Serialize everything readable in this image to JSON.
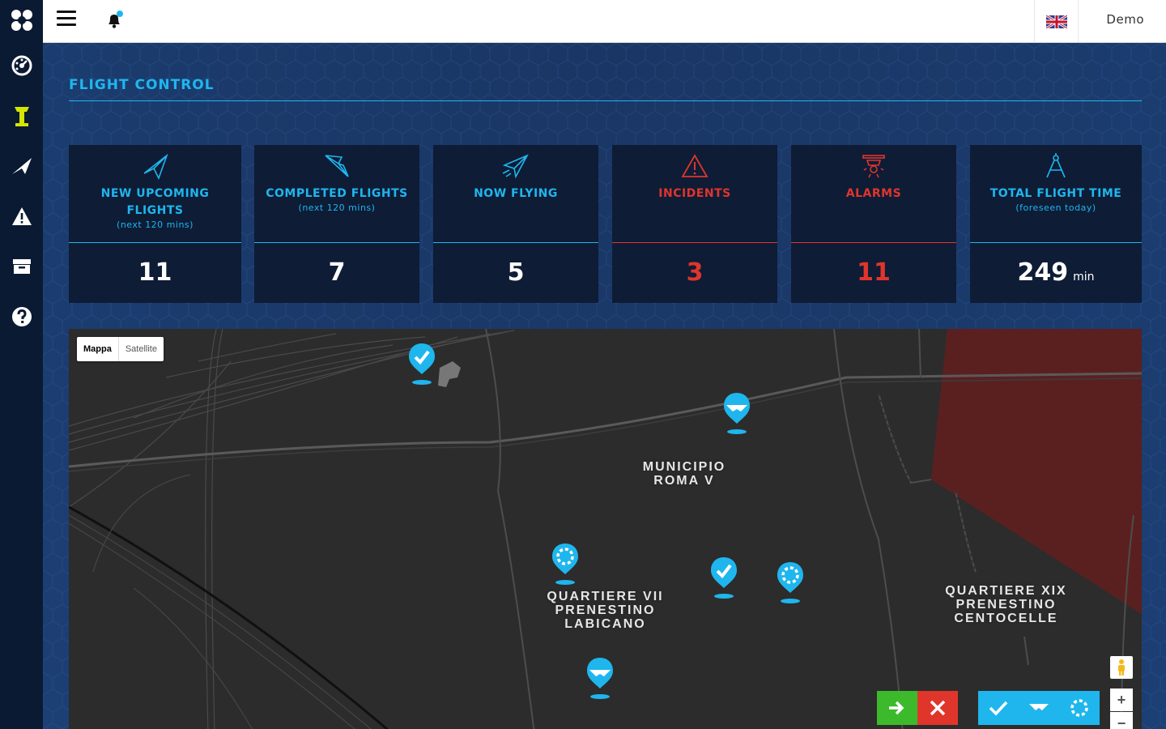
{
  "sidebar": {
    "items": [
      {
        "icon": "logo-icon"
      },
      {
        "icon": "dashboard-gauge-icon"
      },
      {
        "icon": "flight-control-tower-icon",
        "color": "#d4e600"
      },
      {
        "icon": "paper-plane-icon"
      },
      {
        "icon": "warning-icon"
      },
      {
        "icon": "archive-icon"
      },
      {
        "icon": "help-icon"
      }
    ]
  },
  "topbar": {
    "language_flag": "uk-flag-icon",
    "user_name": "Demo",
    "notification_dot_color": "#1fb6ee"
  },
  "page": {
    "title": "FLIGHT CONTROL"
  },
  "cards": [
    {
      "icon": "paper-plane-outline-icon",
      "label": "NEW UPCOMING FLIGHTS",
      "sub": "(next 120 mins)",
      "value": "11",
      "unit": "",
      "color": "#1fb6ee"
    },
    {
      "icon": "folded-plane-icon",
      "label": "COMPLETED FLIGHTS",
      "sub": "(next 120 mins)",
      "value": "7",
      "unit": "",
      "color": "#1fb6ee"
    },
    {
      "icon": "flying-plane-icon",
      "label": "NOW FLYING",
      "sub": "",
      "value": "5",
      "unit": "",
      "color": "#1fb6ee"
    },
    {
      "icon": "warning-triangle-icon",
      "label": "INCIDENTS",
      "sub": "",
      "value": "3",
      "unit": "",
      "color": "#e0352b"
    },
    {
      "icon": "alarm-siren-icon",
      "label": "ALARMS",
      "sub": "",
      "value": "11",
      "unit": "",
      "color": "#e0352b"
    },
    {
      "icon": "compass-drafting-icon",
      "label": "TOTAL FLIGHT TIME",
      "sub": "(foreseen today)",
      "value": "249",
      "unit": "min",
      "color": "#1fb6ee"
    }
  ],
  "map": {
    "type_control": {
      "active": "Mappa",
      "inactive": "Satellite"
    },
    "labels": [
      {
        "text": "MUNICIPIO\nROMA V"
      },
      {
        "text": "QUARTIERE VII\nPRENESTINO\nLABICANO"
      },
      {
        "text": "QUARTIERE XIX\nPRENESTINO\nCENTOCELLE"
      }
    ],
    "pins": [
      {
        "status": "completed",
        "icon": "check-icon"
      },
      {
        "status": "flying",
        "icon": "flying-icon"
      },
      {
        "status": "upcoming",
        "icon": "loading-icon"
      },
      {
        "status": "completed",
        "icon": "check-icon"
      },
      {
        "status": "upcoming",
        "icon": "loading-icon"
      },
      {
        "status": "flying",
        "icon": "flying-icon"
      }
    ],
    "pin_color": "#1fb6ee",
    "no_fly_zone_color": "#5a2020",
    "filters": [
      {
        "name": "enter-arrow-icon",
        "bg": "#3cba2c"
      },
      {
        "name": "close-icon",
        "bg": "#e0352b"
      },
      {
        "name": "check-icon",
        "bg": "#1fb6ee"
      },
      {
        "name": "flying-icon",
        "bg": "#1fb6ee"
      },
      {
        "name": "loading-icon",
        "bg": "#1fb6ee"
      }
    ],
    "zoom": {
      "in": "+",
      "out": "−"
    }
  }
}
